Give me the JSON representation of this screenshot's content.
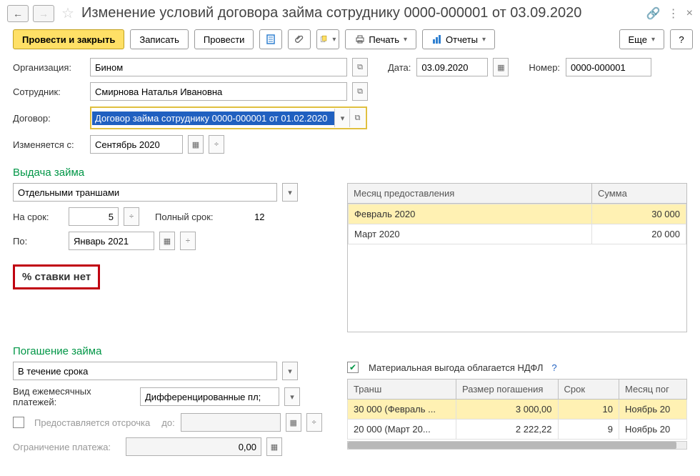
{
  "header": {
    "title": "Изменение условий договора займа сотруднику 0000-000001 от 03.09.2020"
  },
  "toolbar": {
    "post_close": "Провести и закрыть",
    "save": "Записать",
    "post": "Провести",
    "print": "Печать",
    "reports": "Отчеты",
    "more": "Еще",
    "help": "?"
  },
  "fields": {
    "org_label": "Организация:",
    "org_value": "Бином",
    "date_label": "Дата:",
    "date_value": "03.09.2020",
    "number_label": "Номер:",
    "number_value": "0000-000001",
    "employee_label": "Сотрудник:",
    "employee_value": "Смирнова Наталья Ивановна",
    "contract_label": "Договор:",
    "contract_value": "Договор займа сотруднику 0000-000001 от 01.02.2020",
    "changed_from_label": "Изменяется с:",
    "changed_from_value": "Сентябрь 2020"
  },
  "issuance": {
    "title": "Выдача займа",
    "method": "Отдельными траншами",
    "term_label": "На срок:",
    "term_value": "5",
    "full_term_label": "Полный срок:",
    "full_term_value": "12",
    "until_label": "По:",
    "until_value": "Январь 2021",
    "no_rate": "% ставки нет",
    "grid": {
      "col_month": "Месяц предоставления",
      "col_sum": "Сумма",
      "rows": [
        {
          "month": "Февраль 2020",
          "sum": "30 000"
        },
        {
          "month": "Март 2020",
          "sum": "20 000"
        }
      ]
    }
  },
  "repayment": {
    "title": "Погашение займа",
    "during": "В течение срока",
    "payment_type_label": "Вид ежемесячных платежей:",
    "payment_type_value": "Дифференцированные пл;",
    "defer_label": "Предоставляется отсрочка",
    "defer_until_label": "до:",
    "defer_until_value": "",
    "limit_label": "Ограничение платежа:",
    "limit_value": "0,00",
    "benefit_label": "Материальная выгода облагается НДФЛ",
    "grid": {
      "col_tranche": "Транш",
      "col_amount": "Размер погашения",
      "col_term": "Срок",
      "col_month": "Месяц пог",
      "rows": [
        {
          "tranche": "30 000  (Февраль ...",
          "amount": "3 000,00",
          "term": "10",
          "month": "Ноябрь 20"
        },
        {
          "tranche": "20 000  (Март 20...",
          "amount": "2 222,22",
          "term": "9",
          "month": "Ноябрь 20"
        }
      ]
    }
  }
}
